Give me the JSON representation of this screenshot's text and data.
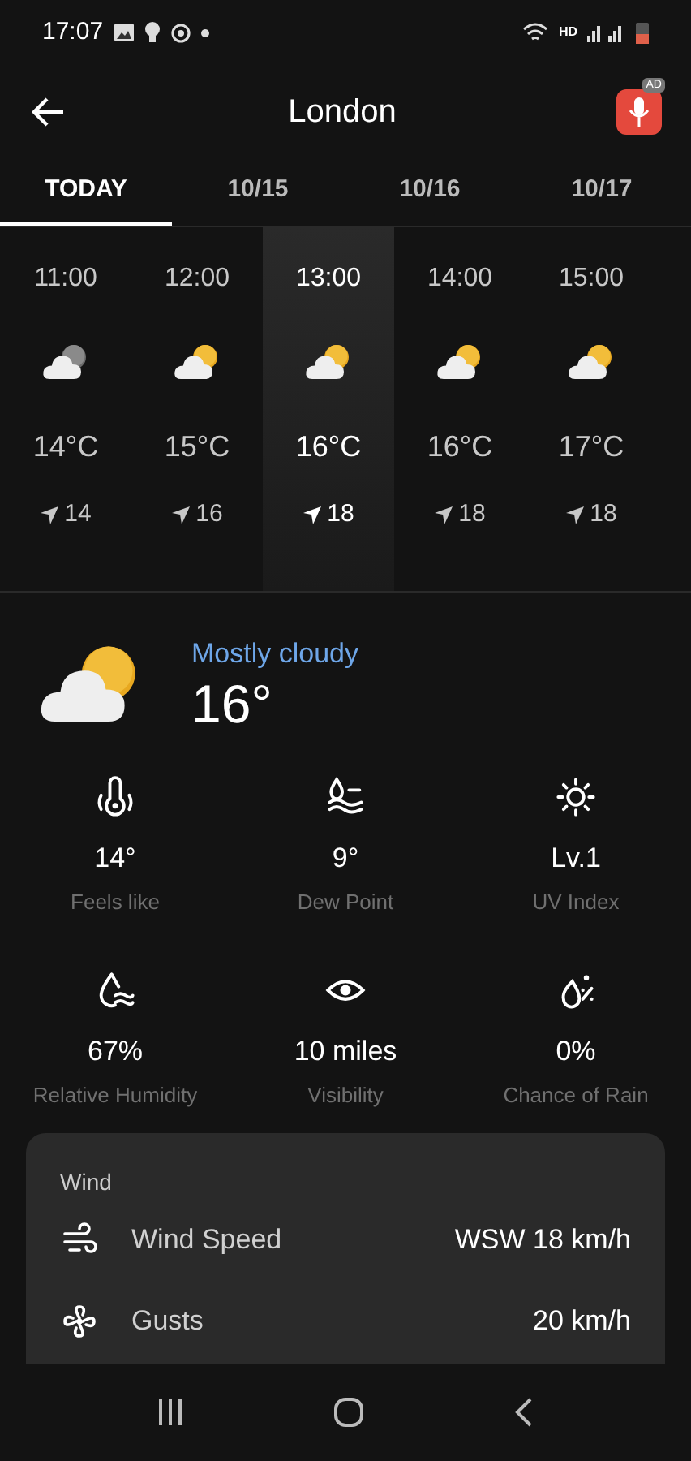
{
  "status_bar": {
    "time": "17:07",
    "network": "HD"
  },
  "header": {
    "title": "London",
    "ad_badge": "AD"
  },
  "tabs": [
    {
      "label": "TODAY",
      "selected": true
    },
    {
      "label": "10/15",
      "selected": false
    },
    {
      "label": "10/16",
      "selected": false
    },
    {
      "label": "10/17",
      "selected": false
    }
  ],
  "hourly": [
    {
      "time": "11:00",
      "kind": "cloudy",
      "temp": "14°C",
      "wind": "14",
      "selected": false
    },
    {
      "time": "12:00",
      "kind": "partly_cloudy",
      "temp": "15°C",
      "wind": "16",
      "selected": false
    },
    {
      "time": "13:00",
      "kind": "partly_cloudy",
      "temp": "16°C",
      "wind": "18",
      "selected": true
    },
    {
      "time": "14:00",
      "kind": "partly_cloudy",
      "temp": "16°C",
      "wind": "18",
      "selected": false
    },
    {
      "time": "15:00",
      "kind": "partly_cloudy",
      "temp": "17°C",
      "wind": "18",
      "selected": false
    }
  ],
  "current": {
    "kind": "partly_cloudy",
    "condition": "Mostly cloudy",
    "temp": "16°"
  },
  "metrics": [
    {
      "kind": "feels_like",
      "value": "14°",
      "label": "Feels like"
    },
    {
      "kind": "dew_point",
      "value": "9°",
      "label": "Dew Point"
    },
    {
      "kind": "uv",
      "value": "Lv.1",
      "label": "UV Index"
    },
    {
      "kind": "humidity",
      "value": "67%",
      "label": "Relative Humidity"
    },
    {
      "kind": "visibility",
      "value": "10 miles",
      "label": "Visibility"
    },
    {
      "kind": "rain",
      "value": "0%",
      "label": "Chance of Rain"
    }
  ],
  "wind_card": {
    "title": "Wind",
    "rows": [
      {
        "kind": "speed",
        "label": "Wind Speed",
        "value": "WSW 18 km/h"
      },
      {
        "kind": "gusts",
        "label": "Gusts",
        "value": "20 km/h"
      }
    ]
  }
}
